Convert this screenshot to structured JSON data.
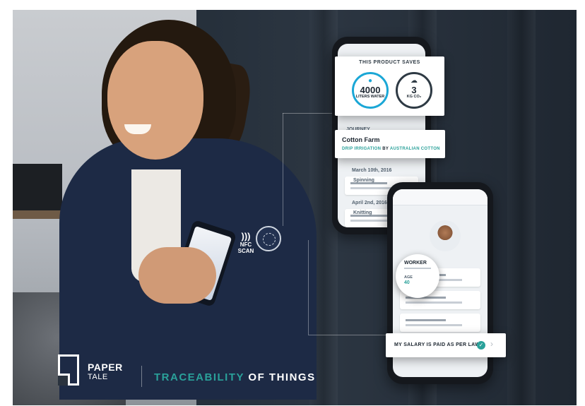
{
  "brand": {
    "name_top": "PAPER",
    "name_bottom": "TALE"
  },
  "tagline": {
    "highlight": "TRACEABILITY",
    "rest": "OF THINGS"
  },
  "nfc_label": "NFC SCAN",
  "saves_card": {
    "title": "THIS PRODUCT SAVES",
    "water_value": "4000",
    "water_unit": "LITERS WATER",
    "co2_value": "3",
    "co2_unit": "KG CO₂"
  },
  "farm_card": {
    "title": "Cotton Farm",
    "method": "DRIP IRRIGATION",
    "by": "BY",
    "company": "AUSTRALIAN COTTON"
  },
  "journey_screen": {
    "label": "JOURNEY",
    "date_1": "March 10th, 2016",
    "step_1": "Spinning",
    "date_2": "April 2nd, 2016",
    "step_2": "Knitting"
  },
  "worker_card": {
    "title": "WORKER",
    "age_label": "AGE",
    "age_value": "40"
  },
  "salary_card": {
    "text": "MY SALARY IS PAID AS PER LAW",
    "check": "✓",
    "chevron": "›"
  },
  "colors": {
    "accent": "#2aa19a",
    "water": "#1ba7d6",
    "dark": "#1c2630"
  }
}
